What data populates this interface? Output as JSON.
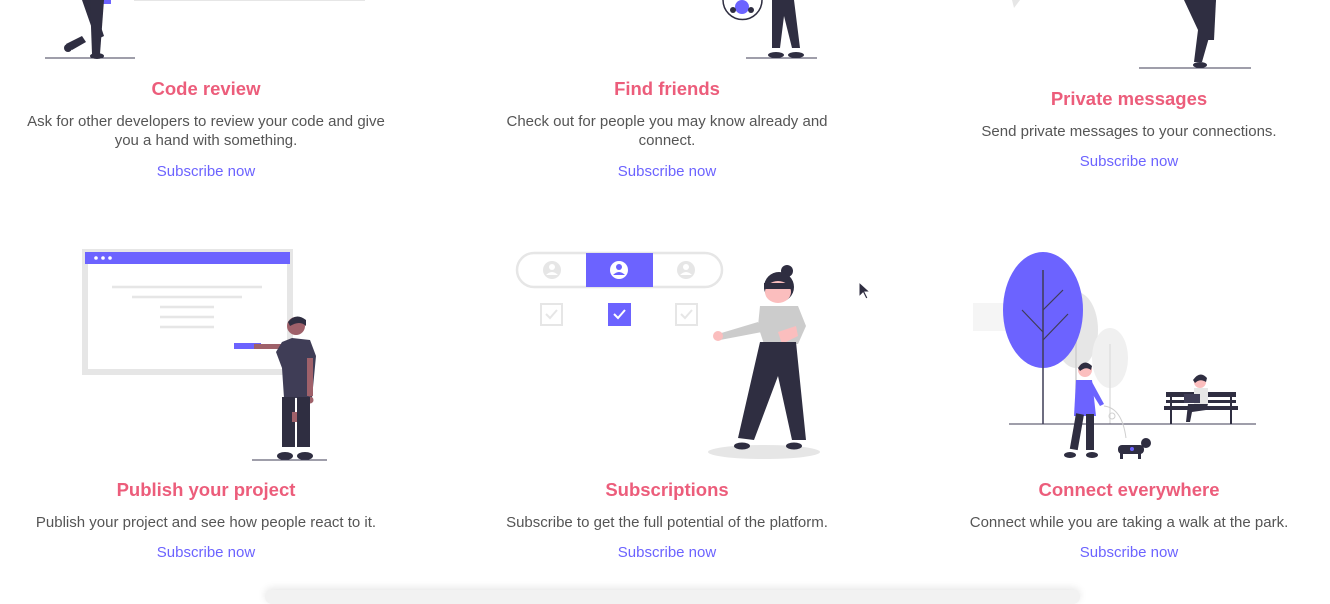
{
  "colors": {
    "accent": "#6c63ff",
    "title": "#ec5d7b",
    "text": "#555555",
    "dark": "#2f2e41"
  },
  "features": [
    {
      "title": "Code review",
      "description": "Ask for other developers to review your code and give you a hand with something.",
      "link": "Subscribe now",
      "icon": "developer-illustration"
    },
    {
      "title": "Find friends",
      "description": "Check out for people you may know already and connect.",
      "link": "Subscribe now",
      "icon": "friends-illustration"
    },
    {
      "title": "Private messages",
      "description": "Send private messages to your connections.",
      "link": "Subscribe now",
      "icon": "messages-illustration"
    },
    {
      "title": "Publish your project",
      "description": "Publish your project and see how people react to it.",
      "link": "Subscribe now",
      "icon": "presentation-illustration"
    },
    {
      "title": "Subscriptions",
      "description": "Subscribe to get the full potential of the platform.",
      "link": "Subscribe now",
      "icon": "subscriptions-illustration"
    },
    {
      "title": "Connect everywhere",
      "description": "Connect while you are taking a walk at the park.",
      "link": "Subscribe now",
      "icon": "park-walk-illustration"
    }
  ]
}
